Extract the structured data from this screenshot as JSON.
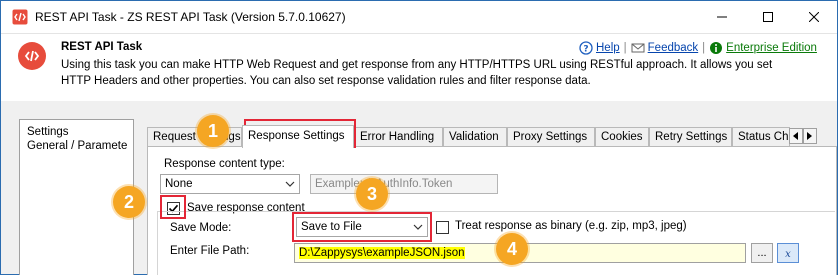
{
  "window": {
    "title": "REST API Task - ZS REST API Task (Version 5.7.0.10627)"
  },
  "header": {
    "task_title": "REST API Task",
    "description": "Using this task you can make HTTP Web Request and get response from any HTTP/HTTPS URL using RESTful approach. It allows you set HTTP Headers and other properties. You can also set response validation rules and filter response data.",
    "help_label": "Help",
    "feedback_label": "Feedback",
    "edition_label": "Enterprise Edition"
  },
  "tree": {
    "items": [
      "Settings",
      "General / Paramete"
    ]
  },
  "tabs": {
    "items": [
      "Request Settings",
      "Response Settings",
      "Error Handling",
      "Validation",
      "Proxy Settings",
      "Cookies",
      "Retry Settings",
      "Status Ch"
    ],
    "active": "Response Settings"
  },
  "response": {
    "content_type_label": "Response content type:",
    "content_type_value": "None",
    "filter_value": "Example: $.AuthInfo.Token",
    "save_label": "Save response content",
    "save_checked": true,
    "save_mode_label": "Save Mode:",
    "save_mode_value": "Save to File",
    "binary_label": "Treat response as binary (e.g. zip, mp3, jpeg)",
    "binary_checked": false,
    "file_path_label": "Enter File Path:",
    "file_path_value": "D:\\Zappysys\\exampleJSON.json",
    "browse_label": "..."
  },
  "annotations": {
    "badges": [
      "1",
      "2",
      "3",
      "4"
    ],
    "color": "#f5a623",
    "highlight_color": "#e32636"
  },
  "colors": {
    "task_icon": "#e74c3c",
    "link": "#0645ad",
    "edition": "#0a7a0a"
  }
}
